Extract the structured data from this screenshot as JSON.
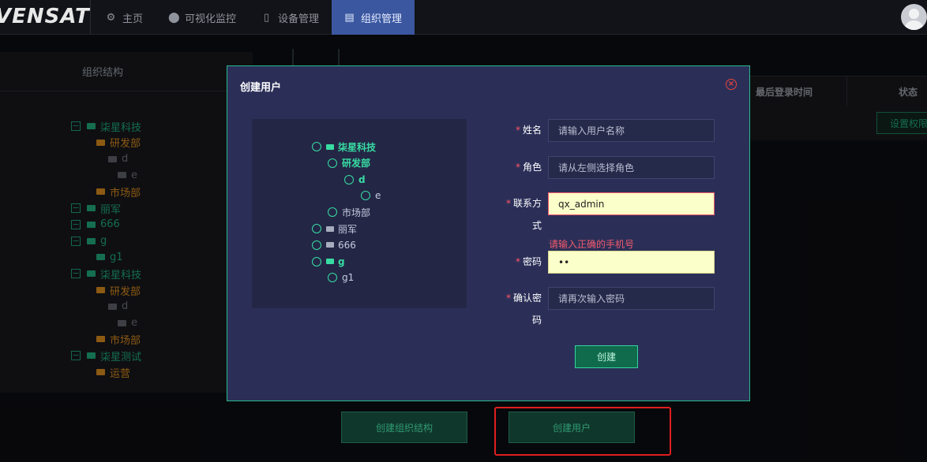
{
  "header": {
    "logo": "VENSAT",
    "nav": [
      {
        "label": "主页",
        "icon": "gear-icon"
      },
      {
        "label": "可视化监控",
        "icon": "location-pin-icon"
      },
      {
        "label": "设备管理",
        "icon": "device-icon"
      },
      {
        "label": "组织管理",
        "icon": "document-icon",
        "active": true
      }
    ]
  },
  "left_panel": {
    "title": "组织结构",
    "tree": [
      {
        "label": "柒星科技",
        "level": 0,
        "color": "green",
        "toggle": "−"
      },
      {
        "label": "研发部",
        "level": 1,
        "color": "orange"
      },
      {
        "label": "d",
        "level": 2,
        "color": "gray"
      },
      {
        "label": "e",
        "level": 3,
        "color": "gray"
      },
      {
        "label": "市场部",
        "level": 1,
        "color": "orange"
      },
      {
        "label": "丽军",
        "level": 0,
        "color": "green",
        "toggle": "−"
      },
      {
        "label": "666",
        "level": 0,
        "color": "green",
        "toggle": "−"
      },
      {
        "label": "g",
        "level": 0,
        "color": "green",
        "toggle": "−"
      },
      {
        "label": "g1",
        "level": 1,
        "color": "green"
      },
      {
        "label": "柒星科技",
        "level": 0,
        "color": "green",
        "toggle": "−"
      },
      {
        "label": "研发部",
        "level": 1,
        "color": "orange"
      },
      {
        "label": "d",
        "level": 2,
        "color": "gray"
      },
      {
        "label": "e",
        "level": 3,
        "color": "gray"
      },
      {
        "label": "市场部",
        "level": 1,
        "color": "orange"
      },
      {
        "label": "柒星测试",
        "level": 0,
        "color": "green",
        "toggle": "−"
      },
      {
        "label": "运营",
        "level": 1,
        "color": "orange"
      }
    ]
  },
  "right_table": {
    "col_last_login": "最后登录时间",
    "col_status": "状态",
    "perm_button": "设置权限"
  },
  "bottom": {
    "create_org_button": "创建组织结构",
    "create_user_button": "创建用户"
  },
  "modal": {
    "title": "创建用户",
    "close_symbol": "×",
    "tree": [
      {
        "label": "柒星科技",
        "level": 0,
        "style": "green",
        "folder": true
      },
      {
        "label": "研发部",
        "level": 1,
        "style": "green",
        "folder": false
      },
      {
        "label": "d",
        "level": 2,
        "style": "green",
        "folder": false
      },
      {
        "label": "e",
        "level": 3,
        "style": "gray",
        "folder": false
      },
      {
        "label": "市场部",
        "level": 1,
        "style": "gray",
        "folder": false
      },
      {
        "label": "丽军",
        "level": 0,
        "style": "gray",
        "folder": true
      },
      {
        "label": "666",
        "level": 0,
        "style": "gray",
        "folder": true
      },
      {
        "label": "g",
        "level": 0,
        "style": "green",
        "folder": true
      },
      {
        "label": "g1",
        "level": 1,
        "style": "gray",
        "folder": false
      }
    ],
    "form": {
      "name_label": "姓名",
      "name_placeholder": "请输入用户名称",
      "role_label": "角色",
      "role_placeholder": "请从左侧选择角色",
      "contact_label_1": "联系方",
      "contact_label_2": "式",
      "contact_value": "qx_admin",
      "contact_error": "请输入正确的手机号",
      "password_label": "密码",
      "password_value": "••",
      "confirm_label_1": "确认密",
      "confirm_label_2": "码",
      "confirm_placeholder": "请再次输入密码",
      "required_mark": "*",
      "submit_label": "创建"
    }
  }
}
